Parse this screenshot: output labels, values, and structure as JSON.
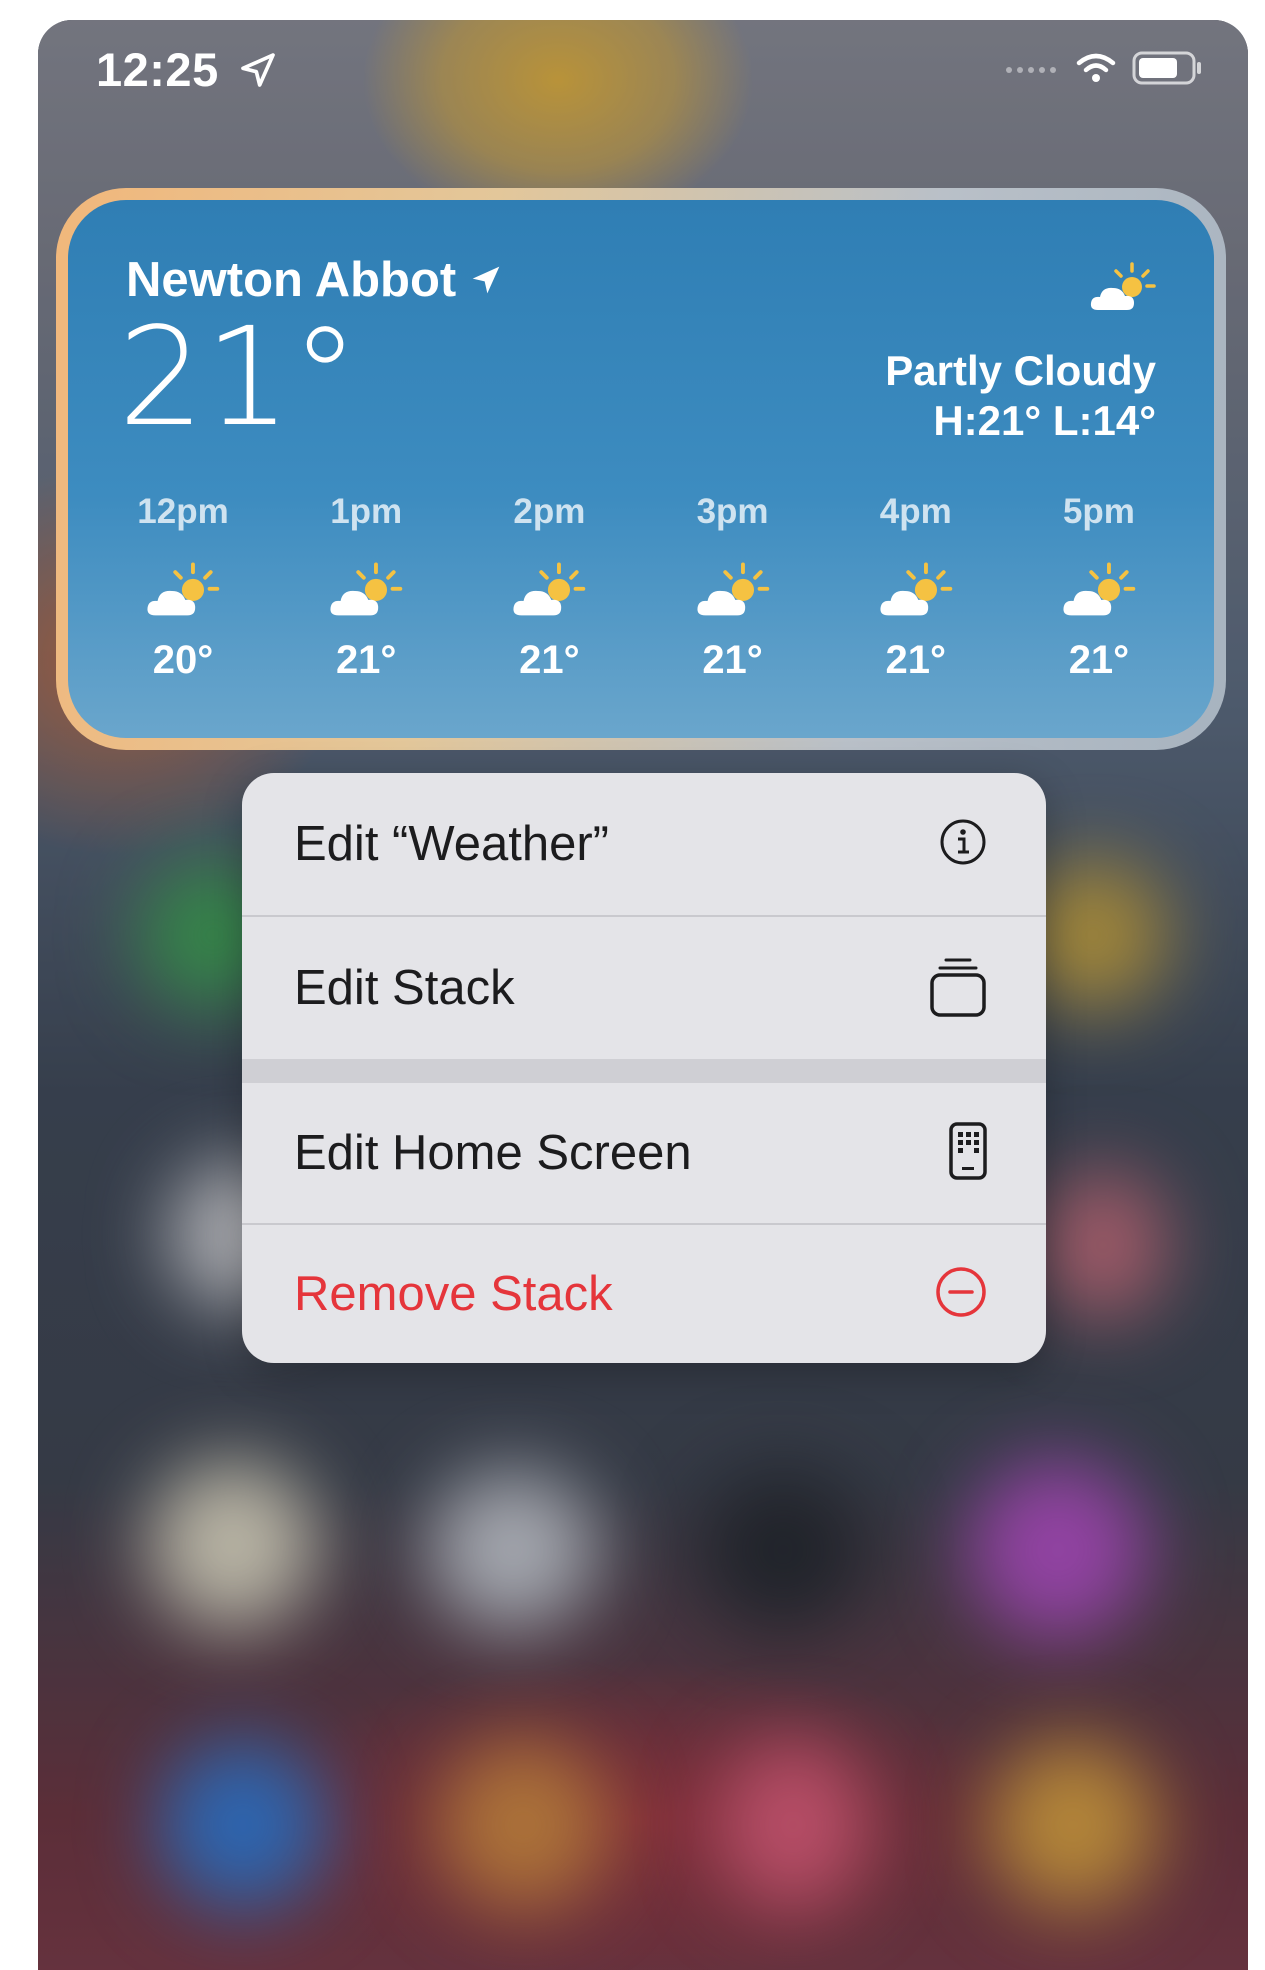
{
  "status_bar": {
    "time": "12:25",
    "location_icon": "location-arrow-icon",
    "signal_icon": "cellular-signal-icon",
    "wifi_icon": "wifi-icon",
    "battery_icon": "battery-icon"
  },
  "weather_widget": {
    "location": "Newton Abbot",
    "temperature": "21°",
    "condition": "Partly Cloudy",
    "high_low": "H:21° L:14°",
    "condition_icon": "partly-cloudy-icon",
    "hourly": [
      {
        "time": "12pm",
        "temp": "20°",
        "icon": "partly-cloudy-icon"
      },
      {
        "time": "1pm",
        "temp": "21°",
        "icon": "partly-cloudy-icon"
      },
      {
        "time": "2pm",
        "temp": "21°",
        "icon": "partly-cloudy-icon"
      },
      {
        "time": "3pm",
        "temp": "21°",
        "icon": "partly-cloudy-icon"
      },
      {
        "time": "4pm",
        "temp": "21°",
        "icon": "partly-cloudy-icon"
      },
      {
        "time": "5pm",
        "temp": "21°",
        "icon": "partly-cloudy-icon"
      }
    ]
  },
  "context_menu": {
    "items": [
      {
        "label": "Edit “Weather”",
        "icon": "info-icon"
      },
      {
        "label": "Edit Stack",
        "icon": "stack-icon"
      },
      {
        "label": "Edit Home Screen",
        "icon": "phone-apps-icon"
      },
      {
        "label": "Remove Stack",
        "icon": "minus-circle-icon"
      }
    ]
  },
  "colors": {
    "widget_blue": "#2f7eb4",
    "destructive_red": "#e5353b",
    "menu_background": "#e4e4e8"
  }
}
